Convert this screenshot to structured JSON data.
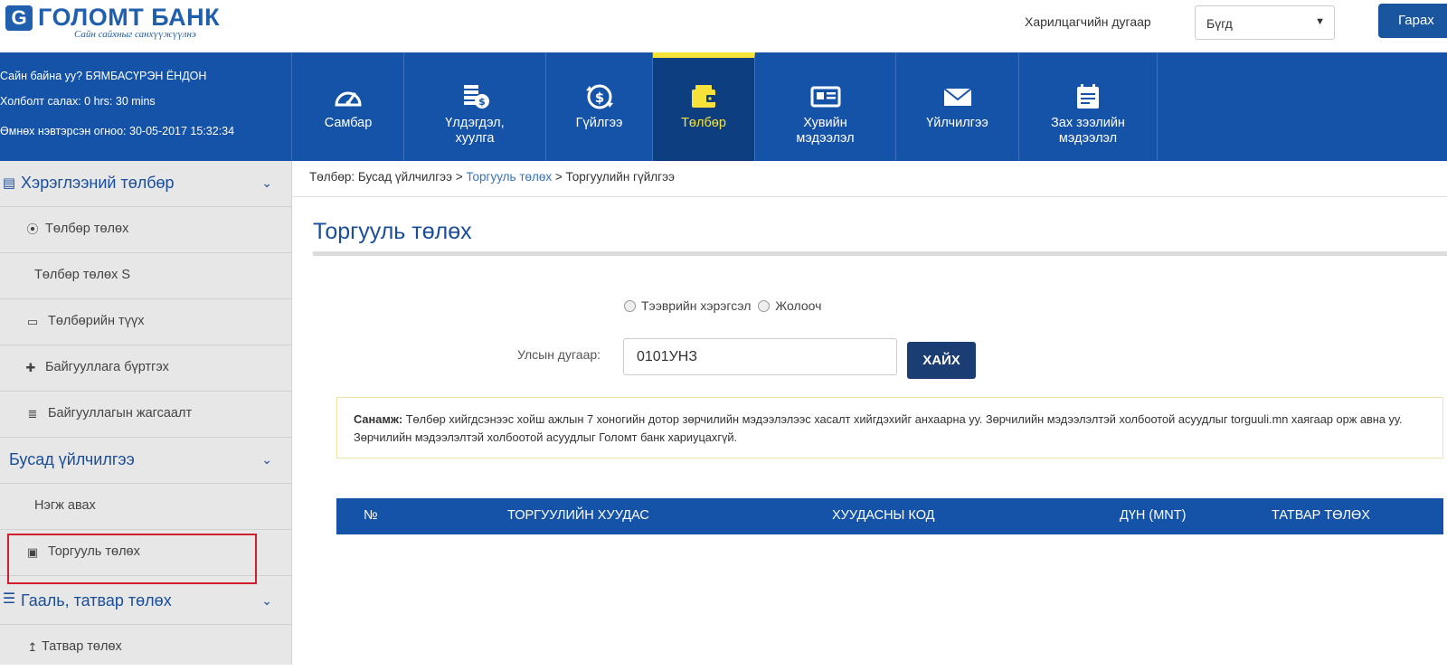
{
  "header": {
    "logo_name": "ГОЛОМТ БАНК",
    "logo_slogan": "Сайн сайхныг санхүүжүүлнэ",
    "customer_number_label": "Харилцагчийн дугаар",
    "customer_select_value": "Бүгд",
    "logout_label": "Гарах"
  },
  "user": {
    "greeting": "Сайн байна уу?  БЯМБАСҮРЭН ЁНДОН",
    "session": "Холболт салах: 0 hrs: 30 mins",
    "last_login": "Өмнөх нэвтэрсэн огноо: 30-05-2017 15:32:34"
  },
  "nav": [
    {
      "label": "Самбар",
      "icon": "dashboard-gauge-icon"
    },
    {
      "label": "Үлдэгдэл, хуулга",
      "icon": "coins-dollar-icon"
    },
    {
      "label": "Гүйлгээ",
      "icon": "dollar-transfer-icon"
    },
    {
      "label": "Төлбөр",
      "icon": "wallet-icon",
      "active": true
    },
    {
      "label": "Хувийн мэдээлэл",
      "icon": "id-card-icon"
    },
    {
      "label": "Үйлчилгээ",
      "icon": "envelope-icon"
    },
    {
      "label": "Зах зээлийн мэдээлэл",
      "icon": "calendar-notes-icon"
    }
  ],
  "sidebar": {
    "items": [
      {
        "label": "Хэрэглээний төлбөр",
        "type": "header",
        "icon": "receipt-icon"
      },
      {
        "label": "Төлбөр төлөх",
        "type": "sub",
        "icon": "circle-dot-icon"
      },
      {
        "label": "Төлбөр төлөх S",
        "type": "sub"
      },
      {
        "label": "Төлбөрийн түүх",
        "type": "sub",
        "icon": "card-list-icon"
      },
      {
        "label": "Байгууллага бүртгэх",
        "type": "sub",
        "icon": "plus-icon"
      },
      {
        "label": "Байгууллагын жагсаалт",
        "type": "sub",
        "icon": "list-icon"
      },
      {
        "label": "Бусад үйлчилгээ",
        "type": "header"
      },
      {
        "label": "Нэгж авах",
        "type": "sub"
      },
      {
        "label": "Торгууль төлөх",
        "type": "sub",
        "icon": "cash-icon",
        "highlighted": true
      },
      {
        "label": "Гааль, татвар төлөх",
        "type": "header",
        "icon": "menu-list-icon"
      },
      {
        "label": "Татвар төлөх",
        "type": "sub",
        "icon": "upload-arrow-icon"
      }
    ]
  },
  "breadcrumb": {
    "part1": "Төлбөр: Бусад үйлчилгээ > ",
    "link": "Торгууль төлөх",
    "part2": " > Торгуулийн гүйлгээ"
  },
  "page": {
    "title": "Торгууль төлөх",
    "radio_vehicle": "Тээврийн хэрэгсэл",
    "radio_driver": "Жолооч",
    "plate_label": "Улсын дугаар:",
    "plate_value": "0101УНЗ",
    "search_button": "ХАЙХ",
    "note_bold": "Санамж:",
    "note_text": " Төлбөр хийгдсэнээс хойш ажлын 7 хоногийн дотор зөрчилийн мэдээлэлээс хасалт хийгдэхийг анхаарна уу. Зөрчилийн мэдээлэлтэй холбоотой асуудлыг torguuli.mn хаягаар орж авна уу. Зөрчилийн мэдээлэлтэй холбоотой асуудлыг Голомт банк хариуцахгүй."
  },
  "table": {
    "headers": [
      "№",
      "ТОРГУУЛИЙН ХУУДАС",
      "ХУУДАСНЫ КОД",
      "ДҮН (MNT)",
      "ТАТВАР ТӨЛӨХ"
    ]
  },
  "colors": {
    "primary": "#1553a8",
    "active_nav": "#0d3f80",
    "active_indicator": "#f7e23a",
    "highlight_border": "#cf1f2f"
  }
}
